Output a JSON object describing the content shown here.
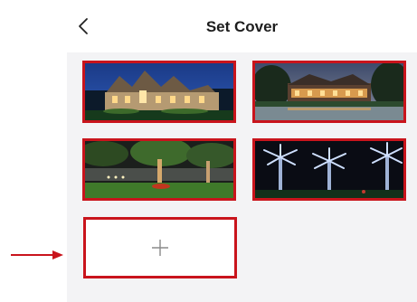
{
  "header": {
    "title": "Set Cover"
  },
  "icons": {
    "back": "chevron-left-icon",
    "add": "plus-icon",
    "pointer": "arrow-right-icon"
  },
  "covers": [
    {
      "name": "stone-house-night"
    },
    {
      "name": "estate-lake-dusk"
    },
    {
      "name": "garden-tree-uplighting"
    },
    {
      "name": "palm-trees-lighting"
    }
  ],
  "colors": {
    "accent": "#c9141c",
    "background": "#f3f3f5",
    "header": "#ffffff"
  }
}
